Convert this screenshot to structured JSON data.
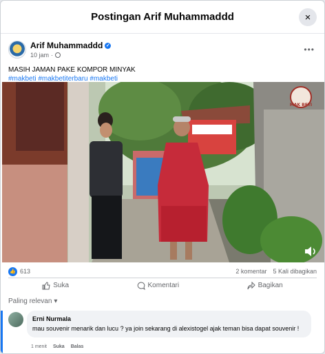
{
  "dialog": {
    "title": "Postingan Arif Muhammaddd",
    "close_icon": "×"
  },
  "post": {
    "author": "Arif Muhammaddd",
    "time": "10 jam",
    "separator": "·",
    "more_icon": "•••",
    "caption": "MASIH JAMAN PAKE KOMPOR MINYAK",
    "hashtags": "#makbeti #makbetiterbaru #makbeti",
    "video_watermark": "MAK BETI"
  },
  "stats": {
    "likes": "613",
    "comments": "2 komentar",
    "shares": "5 Kali dibagikan"
  },
  "actions": {
    "like": "Suka",
    "comment": "Komentari",
    "share": "Bagikan"
  },
  "sort": {
    "label": "Paling relevan"
  },
  "comment": {
    "author": "Erni Nurmala",
    "text": "mau souvenir menarik dan lucu ? ya join sekarang di alexistogel ajak teman bisa dapat souvenir !",
    "time": "1 menit",
    "like": "Suka",
    "reply": "Balas"
  },
  "colors": {
    "accent": "#1877f2",
    "secondary_text": "#65676b"
  }
}
